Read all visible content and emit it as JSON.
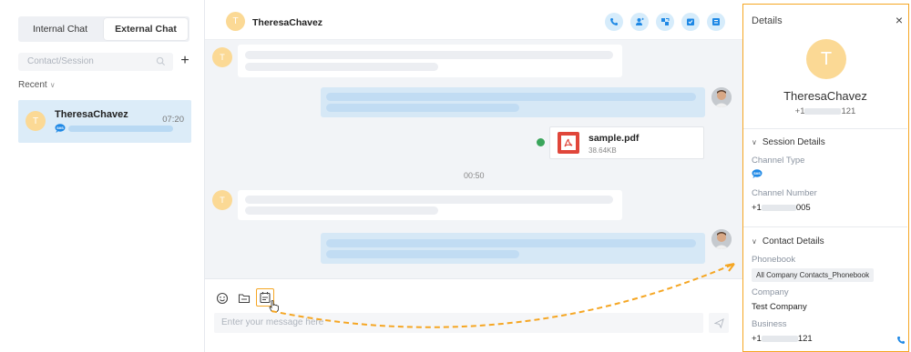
{
  "left_panel": {
    "tabs": [
      {
        "label": "Internal Chat",
        "active": false
      },
      {
        "label": "External Chat",
        "active": true
      }
    ],
    "search_placeholder": "Contact/Session",
    "add_icon": "plus-icon",
    "recent_label": "Recent",
    "session": {
      "avatar_letter": "T",
      "name": "TheresaChavez",
      "time": "07:20",
      "channel_icon": "sms-icon"
    }
  },
  "chat": {
    "header": {
      "avatar_letter": "T",
      "title": "TheresaChavez",
      "actions": [
        "phone-icon",
        "add-contact-icon",
        "transfer-icon",
        "archive-icon",
        "close-session-icon"
      ]
    },
    "messages": {
      "contact_avatar_letter": "T",
      "file": {
        "name": "sample.pdf",
        "size": "38.64KB"
      },
      "timestamp": "00:50"
    },
    "input": {
      "placeholder": "Enter your message here",
      "tools": [
        "emoji-icon",
        "folder-icon",
        "quick-reply-icon"
      ]
    }
  },
  "details": {
    "title": "Details",
    "avatar_letter": "T",
    "name": "TheresaChavez",
    "phone_prefix": "+1",
    "phone_suffix": "121",
    "session_section": {
      "title": "Session Details",
      "channel_type_label": "Channel Type",
      "channel_number_label": "Channel Number",
      "channel_number_prefix": "+1",
      "channel_number_suffix": "005"
    },
    "contact_section": {
      "title": "Contact Details",
      "phonebook_label": "Phonebook",
      "phonebook_value": "All Company Contacts_Phonebook",
      "company_label": "Company",
      "company_value": "Test Company",
      "business_label": "Business",
      "business_prefix": "+1",
      "business_suffix": "121"
    }
  },
  "colors": {
    "accent": "#1e88e5",
    "highlight": "#f5a623",
    "avatar": "#fbd995",
    "outgoing_bubble": "#d6e8f6"
  }
}
